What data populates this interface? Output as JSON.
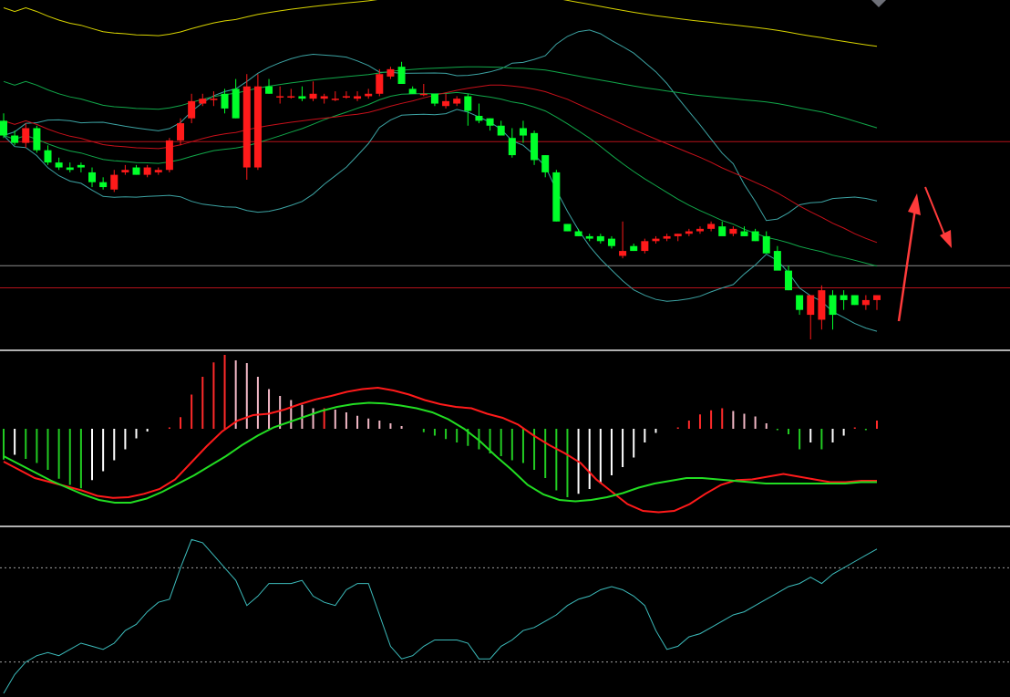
{
  "colors": {
    "background": "#000000",
    "up_candle": "#ff1a1a",
    "down_candle": "#00ff2a",
    "ma_long": "#d8d300",
    "ma_mid": "#c8101a",
    "ma_green": "#11a84a",
    "bollinger": "#3ca3a3",
    "hline_red": "#b5121b",
    "hline_gray": "#8c8c8c",
    "panel_divider": "#b0b0b0",
    "macd_dif": "#ff1a1a",
    "macd_dea": "#22dd22",
    "hist_pos_strong": "#ff2a2a",
    "hist_pos_weak": "#f2b8c6",
    "hist_neg_strong": "#22cc22",
    "hist_neg_weak": "#ffffff",
    "osc_line": "#3cbcbc",
    "osc_guides": "#a0a0a0",
    "arrow": "#ff3b3b"
  },
  "chart_data": [
    {
      "type": "candlestick",
      "title": "",
      "grid": false,
      "ylim": [
        0,
        100
      ],
      "ohlc": [
        [
          59,
          62,
          52,
          53
        ],
        [
          53,
          55,
          49,
          50
        ],
        [
          50,
          58,
          48,
          56
        ],
        [
          56,
          57,
          46,
          47
        ],
        [
          47,
          49,
          41,
          42
        ],
        [
          42,
          44,
          39,
          40
        ],
        [
          40,
          42,
          38,
          39
        ],
        [
          41,
          42,
          38,
          40
        ],
        [
          38,
          40,
          32,
          34
        ],
        [
          34,
          36,
          31,
          32
        ],
        [
          31,
          39,
          30,
          37
        ],
        [
          38,
          41,
          37,
          39
        ],
        [
          40,
          41,
          37,
          37
        ],
        [
          37,
          41,
          36,
          40
        ],
        [
          38,
          40,
          37,
          39
        ],
        [
          39,
          52,
          38,
          51
        ],
        [
          51,
          60,
          49,
          58
        ],
        [
          60,
          70,
          58,
          67
        ],
        [
          66,
          70,
          65,
          68
        ],
        [
          68,
          71,
          65,
          68
        ],
        [
          70,
          72,
          62,
          64
        ],
        [
          72,
          76,
          60,
          60
        ],
        [
          40,
          78,
          35,
          73
        ],
        [
          40,
          78,
          39,
          73
        ],
        [
          73,
          76,
          70,
          70
        ],
        [
          69,
          73,
          66,
          69
        ],
        [
          69,
          72,
          68,
          69
        ],
        [
          69,
          73,
          67,
          68
        ],
        [
          68,
          75,
          67,
          70
        ],
        [
          68,
          70,
          66,
          69
        ],
        [
          68,
          71,
          67,
          68
        ],
        [
          69,
          71,
          68,
          69
        ],
        [
          68,
          71,
          67,
          69
        ],
        [
          69,
          72,
          68,
          70
        ],
        [
          70,
          80,
          69,
          78
        ],
        [
          77,
          81,
          76,
          80
        ],
        [
          81,
          83,
          74,
          74
        ],
        [
          72,
          73,
          70,
          70
        ],
        [
          70,
          74,
          69,
          70
        ],
        [
          70,
          70,
          65,
          66
        ],
        [
          65,
          70,
          64,
          67
        ],
        [
          66,
          69,
          65,
          68
        ],
        [
          69,
          70,
          57,
          63
        ],
        [
          61,
          66,
          58,
          59
        ],
        [
          60,
          60,
          55,
          57
        ],
        [
          57,
          59,
          53,
          53
        ],
        [
          52,
          56,
          44,
          45
        ],
        [
          56,
          59,
          50,
          53
        ],
        [
          54,
          55,
          41,
          43
        ],
        [
          45,
          45,
          36,
          38
        ],
        [
          38,
          39,
          18,
          18
        ],
        [
          17,
          17,
          14,
          14
        ],
        [
          14,
          15,
          12,
          12
        ],
        [
          12,
          13,
          10,
          11
        ],
        [
          12,
          13,
          9,
          10
        ],
        [
          11,
          12,
          7,
          8
        ],
        [
          4,
          18,
          3,
          6
        ],
        [
          8,
          9,
          6,
          6
        ],
        [
          6,
          11,
          5,
          10
        ],
        [
          10,
          12,
          9,
          11
        ],
        [
          11,
          13,
          10,
          12
        ],
        [
          12,
          13,
          10,
          13
        ],
        [
          13,
          15,
          12,
          14
        ],
        [
          14,
          16,
          13,
          15
        ],
        [
          15,
          18,
          14,
          17
        ],
        [
          16,
          18,
          14,
          12
        ],
        [
          13,
          16,
          12,
          15
        ],
        [
          14,
          16,
          12,
          12
        ],
        [
          14,
          15,
          10,
          10
        ],
        [
          12,
          14,
          7,
          5
        ],
        [
          6,
          8,
          2,
          -2
        ],
        [
          -2,
          0,
          -10,
          -10
        ],
        [
          -12,
          -12,
          -20,
          -18
        ],
        [
          -20,
          -12,
          -30,
          -12
        ],
        [
          -22,
          -8,
          -26,
          -10
        ],
        [
          -12,
          -10,
          -26,
          -20
        ],
        [
          -12,
          -10,
          -18,
          -14
        ],
        [
          -12,
          -12,
          -16,
          -16
        ],
        [
          -16,
          -12,
          -18,
          -14
        ],
        [
          -14,
          -12,
          -18,
          -12
        ]
      ],
      "reference_levels": [
        50.5,
        0,
        -9
      ]
    },
    {
      "type": "bar+line",
      "title": "",
      "grid": false,
      "ylim": [
        -1,
        1
      ],
      "histogram": [
        -0.45,
        -0.38,
        -0.44,
        -0.5,
        -0.6,
        -0.73,
        -0.82,
        -0.87,
        -0.75,
        -0.62,
        -0.46,
        -0.3,
        -0.14,
        -0.04,
        0.0,
        0.02,
        0.17,
        0.5,
        0.76,
        0.97,
        1.08,
        1.0,
        0.96,
        0.76,
        0.58,
        0.48,
        0.42,
        0.35,
        0.3,
        0.3,
        0.28,
        0.24,
        0.19,
        0.15,
        0.12,
        0.08,
        0.04,
        0.0,
        -0.05,
        -0.1,
        -0.15,
        -0.2,
        -0.25,
        -0.3,
        -0.36,
        -0.4,
        -0.46,
        -0.5,
        -0.6,
        -0.72,
        -0.9,
        -1.0,
        -0.95,
        -0.88,
        -0.8,
        -0.68,
        -0.56,
        -0.42,
        -0.2,
        -0.06,
        0.0,
        0.02,
        0.12,
        0.21,
        0.27,
        0.3,
        0.26,
        0.22,
        0.18,
        0.08,
        -0.02,
        -0.08,
        -0.3,
        -0.2,
        -0.3,
        -0.2,
        -0.1,
        0.02,
        -0.02,
        0.12
      ],
      "series": [
        {
          "values": [
            -0.48,
            -0.6,
            -0.72,
            -0.78,
            -0.84,
            -0.9,
            -0.98,
            -1.01,
            -1.0,
            -0.95,
            -0.88,
            -0.74,
            -0.5,
            -0.26,
            -0.04,
            0.12,
            0.2,
            0.22,
            0.28,
            0.36,
            0.43,
            0.48,
            0.54,
            0.58,
            0.6,
            0.56,
            0.5,
            0.42,
            0.36,
            0.32,
            0.3,
            0.22,
            0.16,
            0.06,
            -0.1,
            -0.24,
            -0.36,
            -0.5,
            -0.74,
            -0.92,
            -1.1,
            -1.2,
            -1.22,
            -1.2,
            -1.1,
            -0.95,
            -0.82,
            -0.75,
            -0.74,
            -0.7,
            -0.66,
            -0.7,
            -0.74,
            -0.78,
            -0.78,
            -0.76,
            -0.76
          ]
        },
        {
          "values": [
            -0.4,
            -0.52,
            -0.64,
            -0.76,
            -0.86,
            -0.96,
            -1.04,
            -1.08,
            -1.08,
            -1.02,
            -0.92,
            -0.8,
            -0.68,
            -0.54,
            -0.4,
            -0.24,
            -0.1,
            0.02,
            0.1,
            0.18,
            0.26,
            0.32,
            0.36,
            0.38,
            0.37,
            0.34,
            0.3,
            0.24,
            0.14,
            0.0,
            -0.18,
            -0.4,
            -0.6,
            -0.82,
            -0.96,
            -1.04,
            -1.06,
            -1.04,
            -1.0,
            -0.94,
            -0.86,
            -0.8,
            -0.76,
            -0.72,
            -0.72,
            -0.74,
            -0.76,
            -0.78,
            -0.8,
            -0.8,
            -0.8,
            -0.8,
            -0.8,
            -0.8,
            -0.78,
            -0.78
          ]
        }
      ]
    },
    {
      "type": "line",
      "title": "",
      "grid": false,
      "ylim": [
        0,
        100
      ],
      "reference_levels": [
        80,
        20
      ],
      "series": [
        {
          "values": [
            0,
            12,
            20,
            24,
            26,
            24,
            28,
            32,
            30,
            28,
            32,
            40,
            44,
            52,
            58,
            60,
            80,
            98,
            96,
            88,
            80,
            72,
            56,
            62,
            70,
            70,
            70,
            72,
            62,
            58,
            56,
            66,
            70,
            70,
            50,
            30,
            22,
            24,
            30,
            34,
            34,
            34,
            32,
            22,
            22,
            30,
            34,
            40,
            42,
            46,
            50,
            56,
            60,
            62,
            66,
            68,
            66,
            62,
            56,
            40,
            28,
            30,
            36,
            38,
            42,
            46,
            50,
            52,
            56,
            60,
            64,
            68,
            70,
            74,
            70,
            76,
            80,
            84,
            88,
            92
          ]
        }
      ]
    }
  ]
}
